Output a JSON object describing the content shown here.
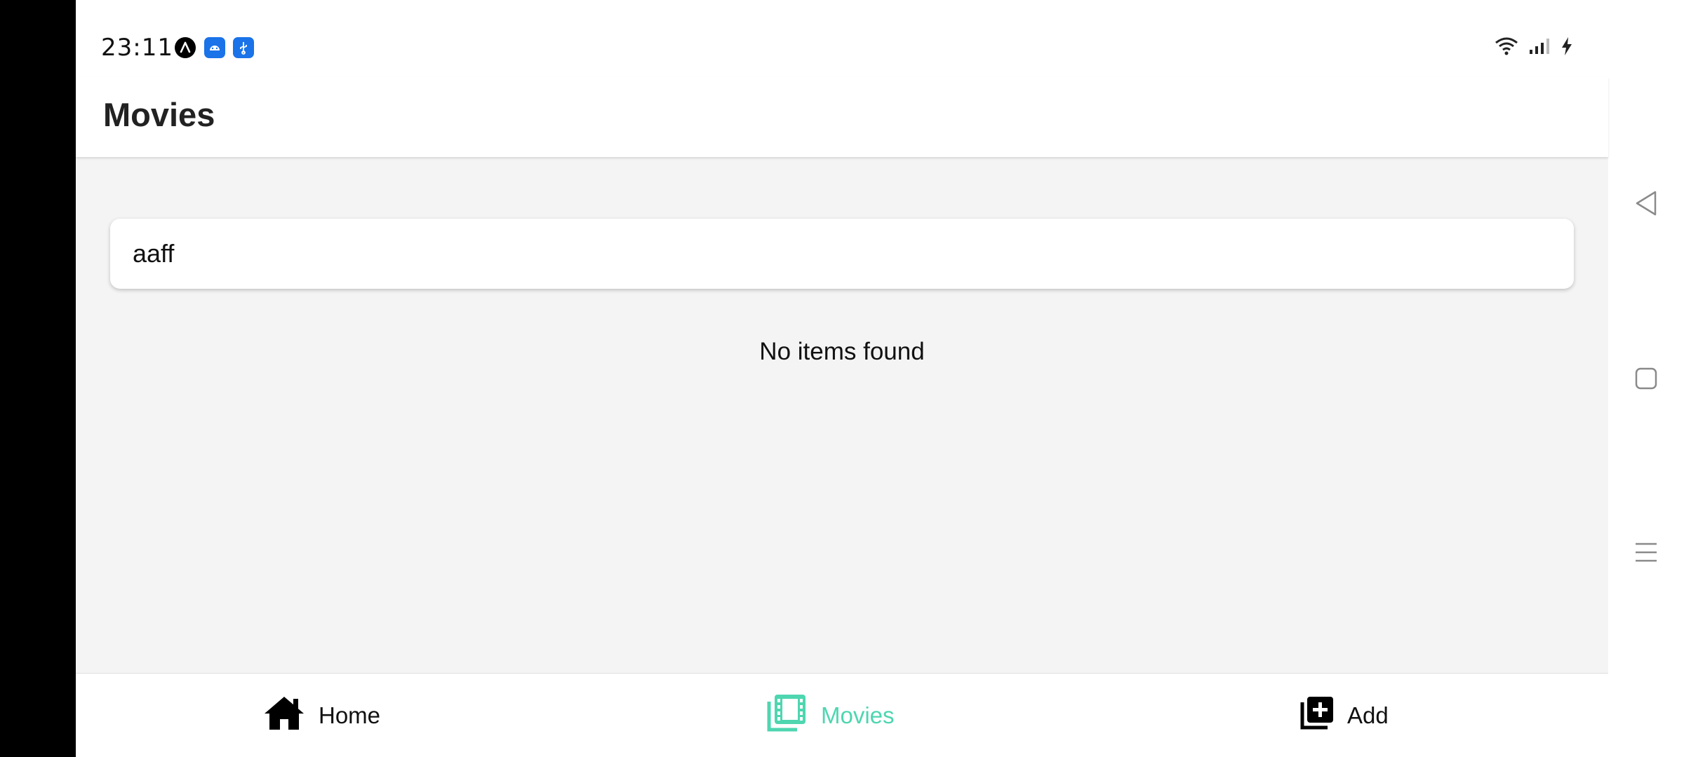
{
  "status_bar": {
    "time": "23:11",
    "notification_icons": [
      "expo-icon",
      "android-debug-icon",
      "usb-icon"
    ],
    "system_icons": [
      "wifi-icon",
      "signal-icon",
      "charging-icon"
    ]
  },
  "app_bar": {
    "title": "Movies"
  },
  "search": {
    "value": "aaff"
  },
  "list": {
    "empty_message": "No items found"
  },
  "bottom_nav": {
    "items": [
      {
        "label": "Home",
        "icon": "home-icon"
      },
      {
        "label": "Movies",
        "icon": "movie-library-icon",
        "active": true
      },
      {
        "label": "Add",
        "icon": "add-library-icon"
      }
    ],
    "active_color": "#4ed6b0"
  },
  "system_nav": {
    "buttons": [
      "back-icon",
      "home-square-icon",
      "recents-menu-icon"
    ]
  }
}
